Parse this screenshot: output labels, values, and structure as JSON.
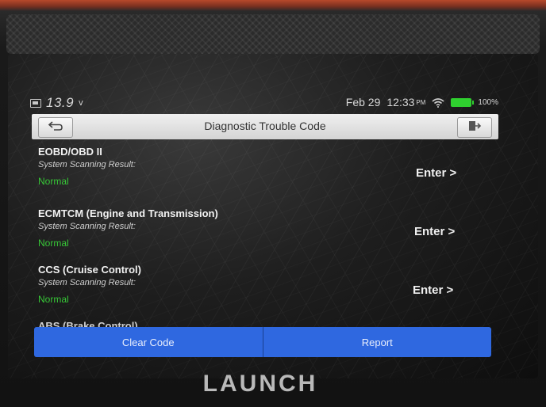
{
  "status_bar": {
    "voltage": "13.9",
    "voltage_unit": "v",
    "date": "Feb 29",
    "time": "12:33",
    "ampm": "PM",
    "battery_percent": "100%"
  },
  "header": {
    "title": "Diagnostic Trouble Code"
  },
  "systems": [
    {
      "name": "EOBD/OBD II",
      "result_label": "System Scanning Result:",
      "status": "Normal",
      "enter_label": "Enter >"
    },
    {
      "name": "ECMTCM (Engine and Transmission)",
      "result_label": "System Scanning Result:",
      "status": "Normal",
      "enter_label": "Enter >"
    },
    {
      "name": "CCS (Cruise Control)",
      "result_label": "System Scanning Result:",
      "status": "Normal",
      "enter_label": "Enter >"
    },
    {
      "name": "ABS (Brake Control)"
    }
  ],
  "footer": {
    "clear_code_label": "Clear Code",
    "report_label": "Report"
  },
  "device": {
    "brand": "LAUNCH"
  },
  "colors": {
    "status_normal": "#37c637",
    "button_blue": "#2f68e0",
    "battery_green": "#2fd02f"
  },
  "icons": [
    "battery-icon",
    "wifi-icon",
    "back-icon",
    "exit-icon"
  ]
}
